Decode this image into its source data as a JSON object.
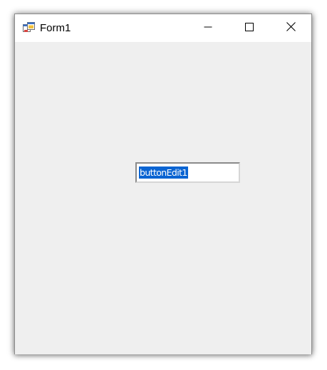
{
  "window": {
    "title": "Form1",
    "icon": "winforms-app-icon"
  },
  "titlebar": {
    "minimize_icon": "minimize-icon",
    "maximize_icon": "maximize-icon",
    "close_icon": "close-icon"
  },
  "button_edit": {
    "value": "buttonEdit1",
    "selected": true,
    "selection_color": "#0a64d2"
  }
}
